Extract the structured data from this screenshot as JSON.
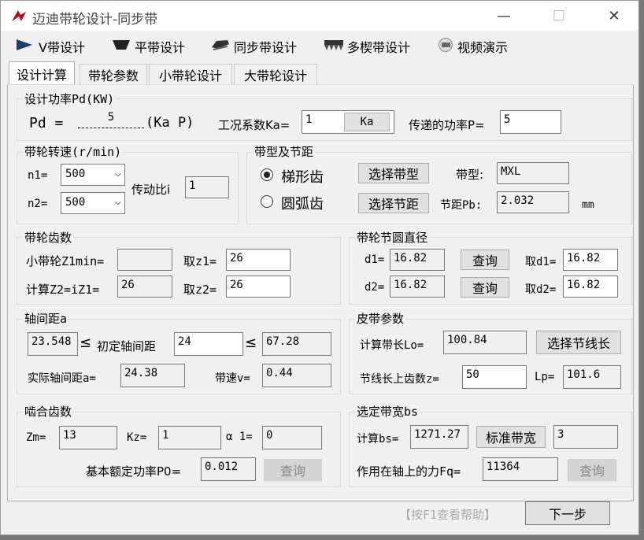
{
  "window": {
    "title": "迈迪带轮设计-同步带",
    "minimize": "—",
    "maximize": "☐",
    "close": "✕"
  },
  "toolbar": [
    {
      "label": "V带设计"
    },
    {
      "label": "平带设计"
    },
    {
      "label": "同步带设计"
    },
    {
      "label": "多楔带设计"
    },
    {
      "label": "视频演示"
    }
  ],
  "tabs": [
    "设计计算",
    "带轮参数",
    "小带轮设计",
    "大带轮设计"
  ],
  "power": {
    "title": "设计功率Pd(KW)",
    "pd_prefix": "Pd = ",
    "pd_value": "5",
    "pd_suffix": "(Ka P)",
    "ka_label": "工况系数Ka=",
    "ka_value": "1",
    "ka_button": "Ka",
    "p_label": "传递的功率P=",
    "p_value": "5"
  },
  "speed": {
    "title": "带轮转速(r/min)",
    "n1_label": "n1=",
    "n1_value": "500",
    "n2_label": "n2=",
    "n2_value": "500",
    "ratio_label": "传动比i",
    "ratio_value": "1"
  },
  "belt_type": {
    "title": "带型及节距",
    "radio_trapezoid": "梯形齿",
    "radio_arc": "圆弧齿",
    "select_type_button": "选择带型",
    "type_label": "带型:",
    "type_value": "MXL",
    "select_pitch_button": "选择节距",
    "pitch_label": "节距Pb:",
    "pitch_value": "2.032",
    "pitch_unit": "mm"
  },
  "teeth": {
    "title": "带轮齿数",
    "z1min_label": "小带轮Z1min=",
    "z1min_value": "",
    "z1_label": "取z1=",
    "z1_value": "26",
    "z2calc_label": "计算Z2=iZ1=",
    "z2calc_value": "26",
    "z2_label": "取z2=",
    "z2_value": "26"
  },
  "diameter": {
    "title": "带轮节圆直径",
    "d1_label": "d1=",
    "d1_value": "16.82",
    "query": "查询",
    "take_d1_label": "取d1=",
    "take_d1_value": "16.82",
    "d2_label": "d2=",
    "d2_value": "16.82",
    "take_d2_label": "取d2=",
    "take_d2_value": "16.82"
  },
  "center": {
    "title": "轴间距a",
    "min_value": "23.548",
    "le1": "≤",
    "initial_label": "初定轴间距",
    "initial_value": "24",
    "le2": "≤",
    "max_value": "67.28",
    "actual_label": "实际轴间距a=",
    "actual_value": "24.38",
    "speed_label": "带速v=",
    "speed_value": "0.44"
  },
  "belt_params": {
    "title": "皮带参数",
    "lo_label": "计算带长Lo=",
    "lo_value": "100.84",
    "select_length_button": "选择节线长",
    "teeth_label": "节线长上齿数z=",
    "teeth_value": "50",
    "lp_label": "Lp=",
    "lp_value": "101.6"
  },
  "mesh": {
    "title": "啮合齿数",
    "zm_label": "Zm=",
    "zm_value": "13",
    "kz_label": "Kz=",
    "kz_value": "1",
    "alpha_label": "α 1=",
    "alpha_value": "0",
    "p0_label": "基本额定功率P0=",
    "p0_value": "0.012",
    "query": "查询"
  },
  "width": {
    "title": "选定带宽bs",
    "bs_label": "计算bs=",
    "bs_value": "1271.27",
    "std_button": "标准带宽",
    "std_value": "3",
    "force_label": "作用在轴上的力Fq=",
    "force_value": "11364",
    "query": "查询"
  },
  "footer": {
    "help": "【按F1查看帮助】",
    "next": "下一步"
  }
}
